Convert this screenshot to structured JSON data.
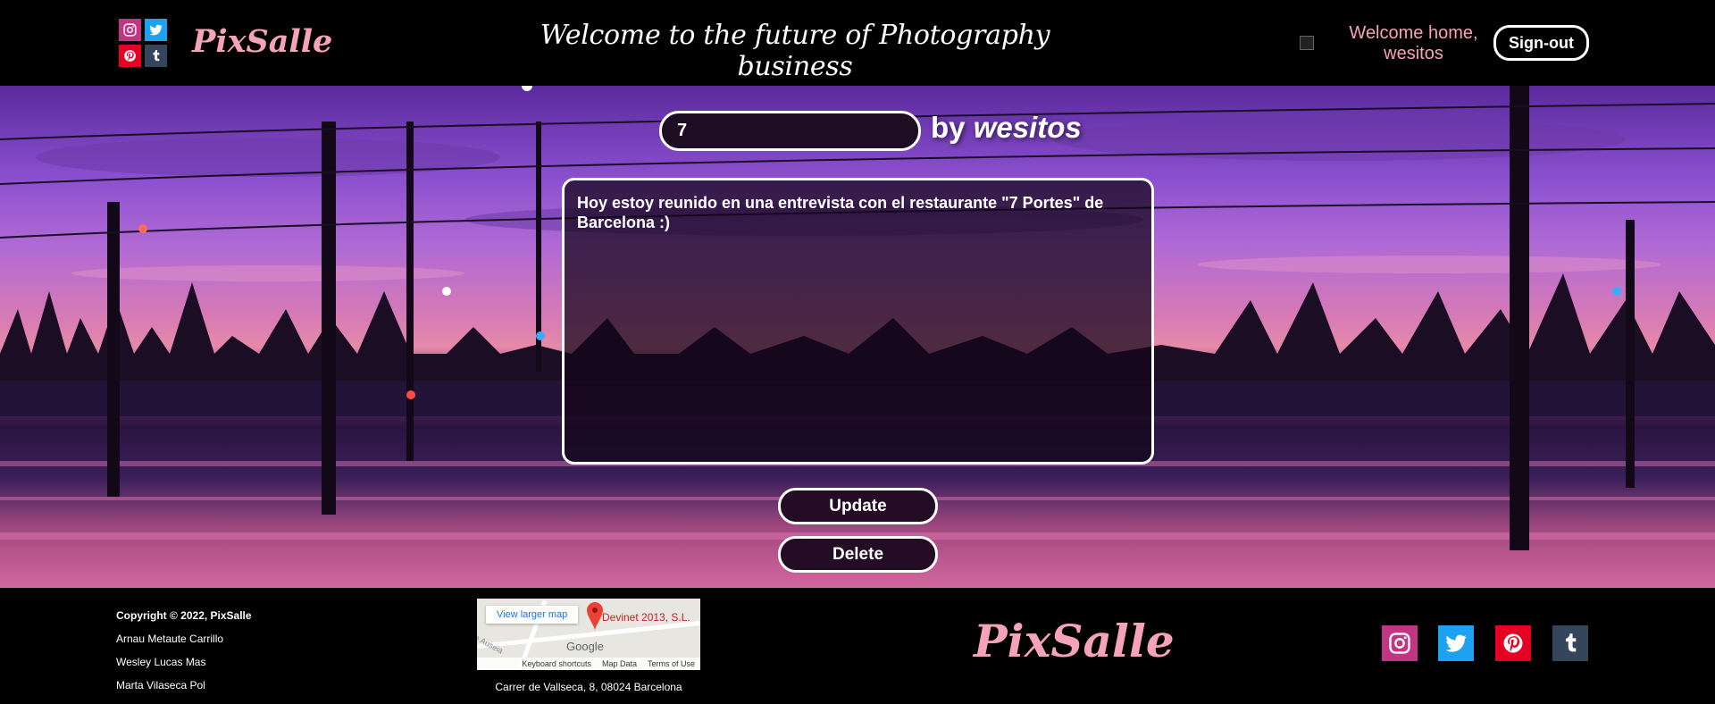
{
  "header": {
    "brand": "PixSalle",
    "tagline": "Welcome to the future of Photography business",
    "welcome": "Welcome home, wesitos",
    "signout_label": "Sign-out"
  },
  "post": {
    "title_value": "7",
    "by_label": "by",
    "author": "wesitos",
    "description": "Hoy estoy reunido en una entrevista con el restaurante \"7 Portes\" de Barcelona :)",
    "update_label": "Update",
    "delete_label": "Delete"
  },
  "footer": {
    "copyright": "Copyright © 2022, PixSalle",
    "authors": [
      "Arnau Metaute Carrillo",
      "Wesley Lucas Mas",
      "Marta Vilaseca Pol"
    ],
    "map": {
      "larger_map": "View larger map",
      "place": "Devinet 2013, S.L.",
      "google": "Google",
      "street": "e Auseia",
      "keyboard": "Keyboard shortcuts",
      "map_data": "Map Data",
      "terms": "Terms of Use"
    },
    "address": "Carrer de Vallseca, 8, 08024 Barcelona",
    "brand": "PixSalle"
  },
  "social": [
    "instagram-icon",
    "twitter-icon",
    "pinterest-icon",
    "tumblr-icon"
  ],
  "colors": {
    "brand_pink": "#f5a3b8",
    "instagram": "#c13584",
    "twitter": "#1da1f2",
    "pinterest": "#e60023",
    "tumblr": "#35465c"
  }
}
